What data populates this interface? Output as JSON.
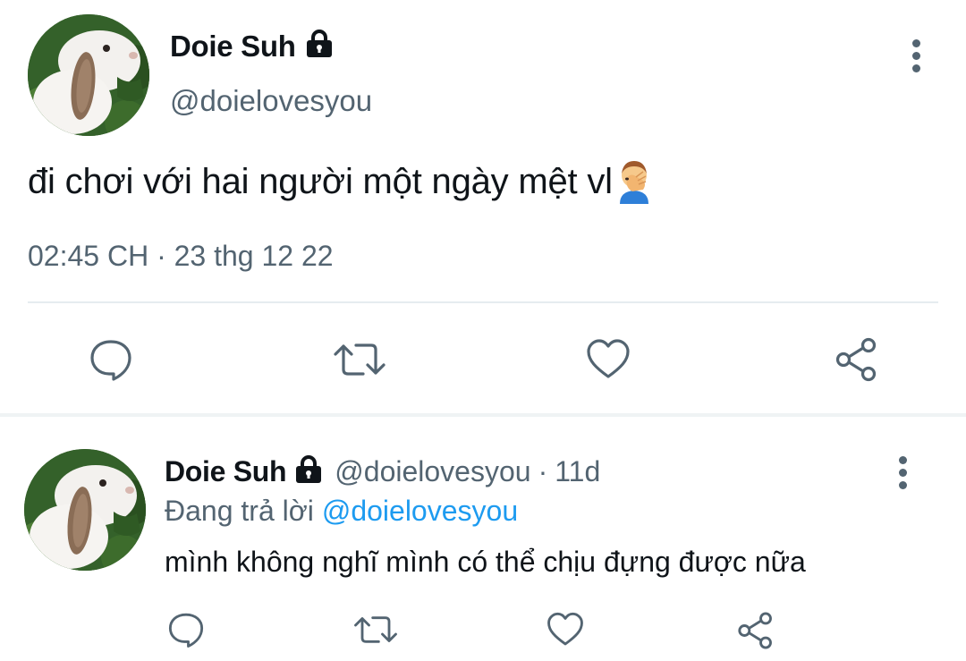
{
  "main_tweet": {
    "display_name": "Doie Suh",
    "handle": "@doielovesyou",
    "text": "đi chơi với hai người một ngày mệt vl",
    "emoji": "facepalm-emoji",
    "timestamp": "02:45 CH · 23 thg 12 22",
    "protected": true,
    "actions": [
      "reply-icon",
      "retweet-icon",
      "like-icon",
      "share-icon"
    ]
  },
  "reply_tweet": {
    "display_name": "Doie Suh",
    "handle": "@doielovesyou",
    "separator": "·",
    "time_ago": "11d",
    "replying_label": "Đang trả lời",
    "replying_to": "@doielovesyou",
    "text": "mình không nghĩ mình có thể chịu đựng được nữa",
    "protected": true,
    "actions": [
      "reply-icon",
      "retweet-icon",
      "like-icon",
      "share-icon"
    ]
  },
  "colors": {
    "text_primary": "#0f1419",
    "text_secondary": "#536471",
    "link": "#1d9bf0",
    "divider": "#e6ecf0"
  }
}
